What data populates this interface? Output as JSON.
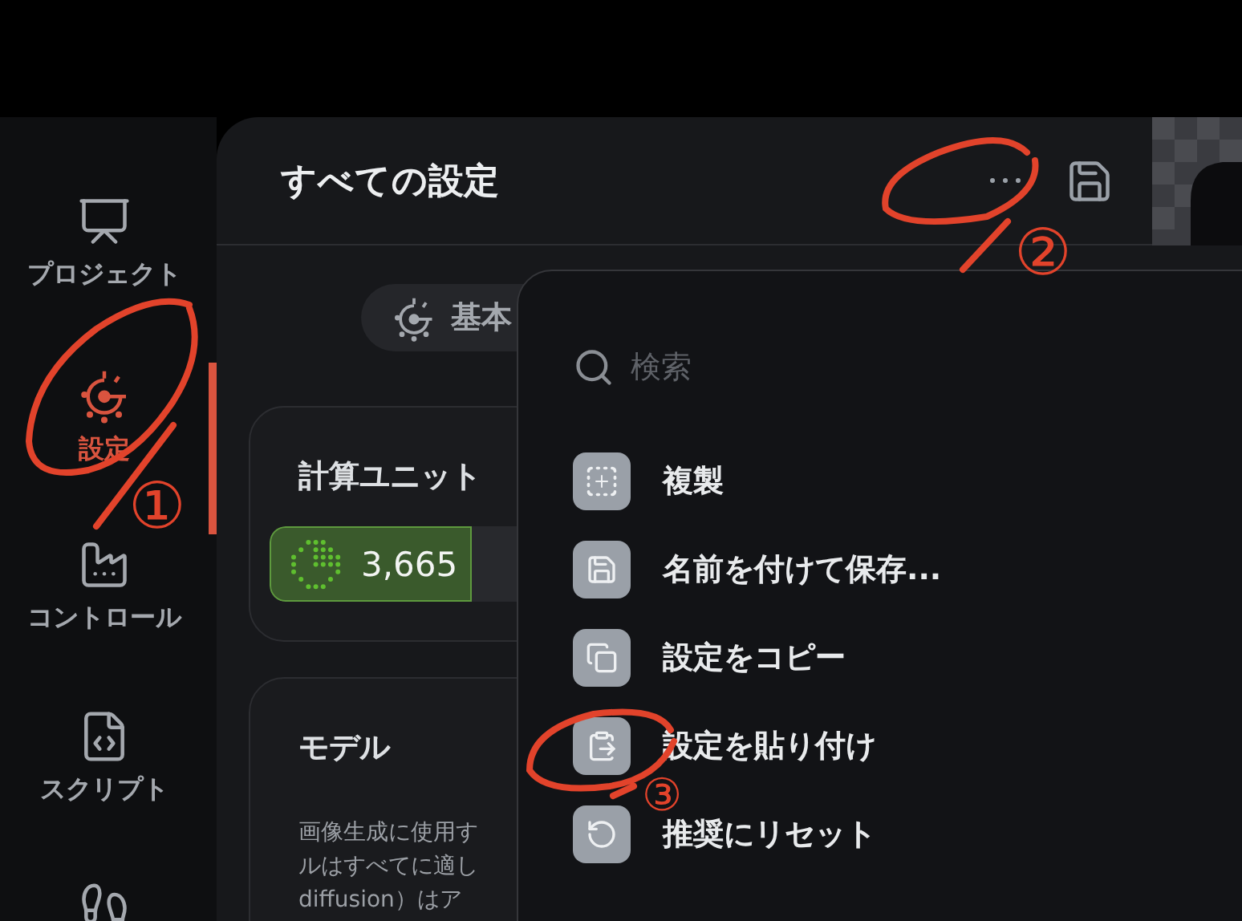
{
  "sidebar": {
    "items": [
      {
        "label": "プロジェクト",
        "selected": false
      },
      {
        "label": "設定",
        "selected": true
      },
      {
        "label": "コントロール",
        "selected": false
      },
      {
        "label": "スクリプト",
        "selected": false
      },
      {
        "selected": false
      }
    ]
  },
  "header": {
    "title": "すべての設定"
  },
  "tab_pill": {
    "label": "基本"
  },
  "cards": [
    {
      "title": "計算ユニット",
      "value": "3,665"
    },
    {
      "title": "モデル",
      "description": [
        "画像生成に使用す",
        "ルはすべてに適し",
        "diffusion）はア"
      ]
    }
  ],
  "menu": {
    "search": {
      "placeholder": "検索"
    },
    "items": [
      {
        "label": "複製"
      },
      {
        "label": "名前を付けて保存..."
      },
      {
        "label": "設定をコピー"
      },
      {
        "label": "設定を貼り付け"
      },
      {
        "label": "推奨にリセット"
      }
    ]
  },
  "annotations": [
    {
      "label": "①"
    },
    {
      "label": "②"
    },
    {
      "label": "③"
    }
  ]
}
